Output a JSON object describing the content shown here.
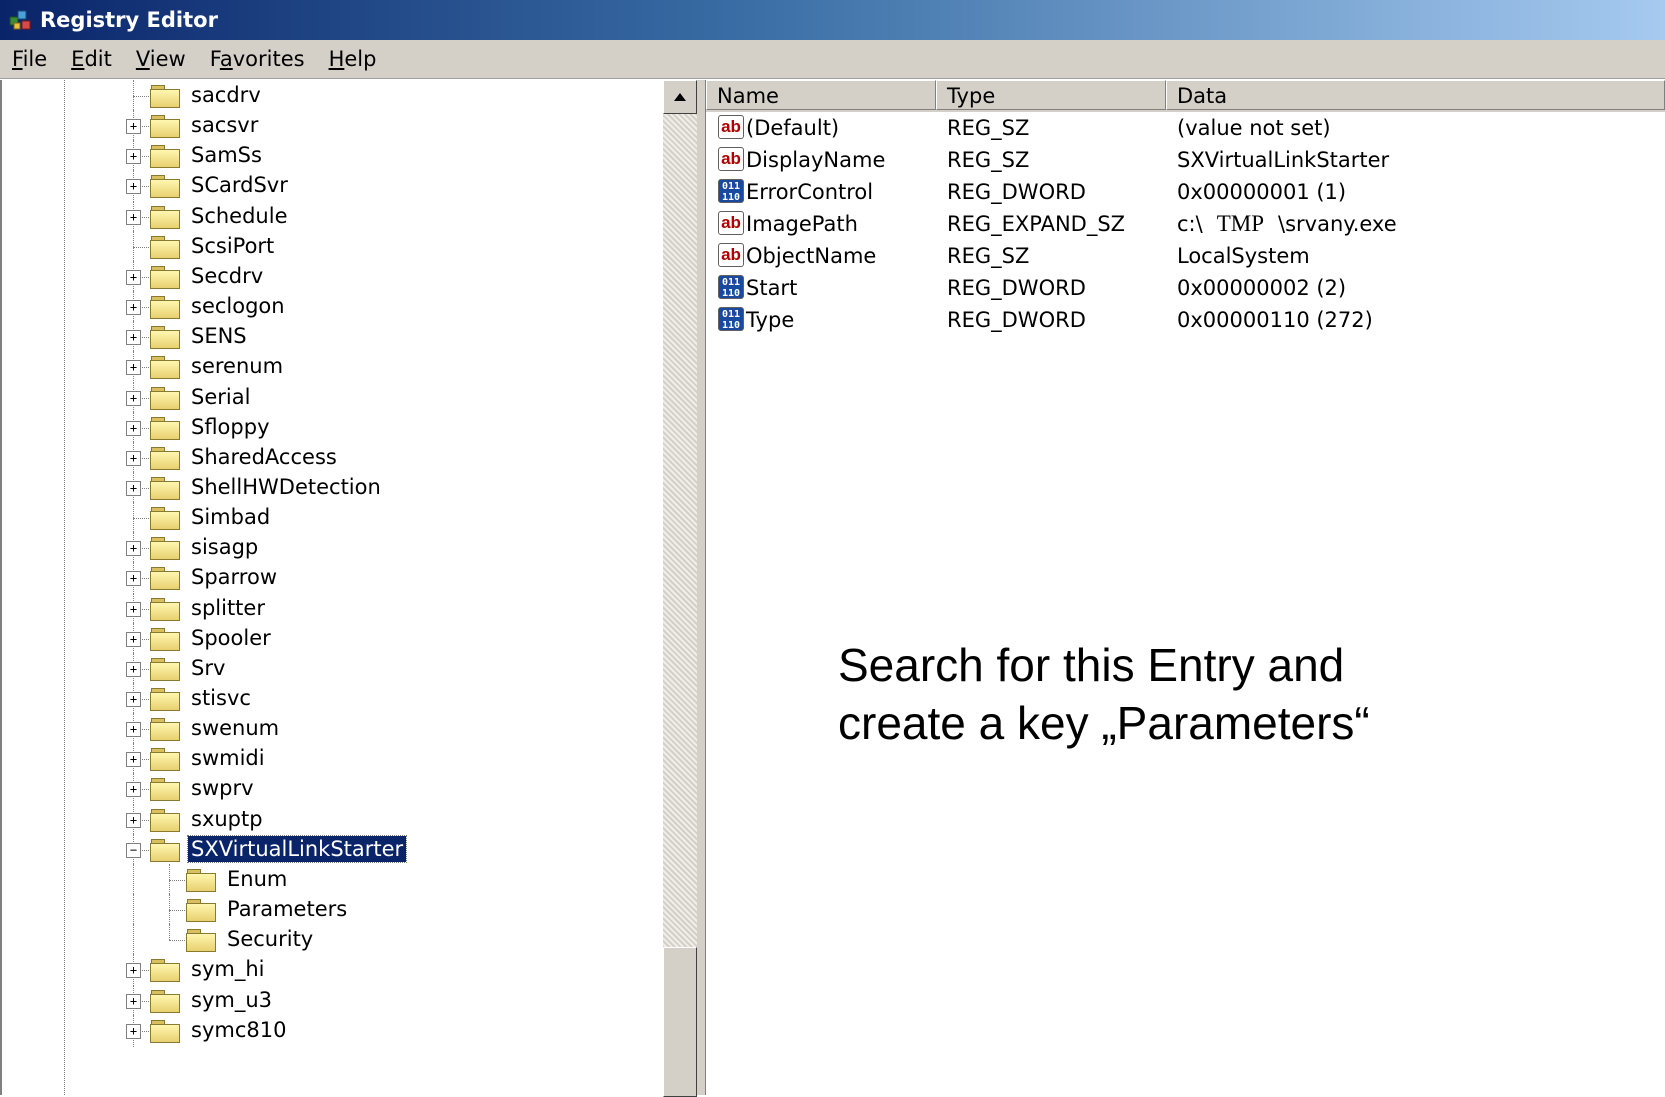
{
  "window": {
    "title": "Registry Editor"
  },
  "menu": [
    {
      "label": "File"
    },
    {
      "label": "Edit"
    },
    {
      "label": "View"
    },
    {
      "label": "Favorites"
    },
    {
      "label": "Help"
    }
  ],
  "tree": [
    {
      "label": "sacdrv",
      "expander": "",
      "level": 1
    },
    {
      "label": "sacsvr",
      "expander": "+",
      "level": 1
    },
    {
      "label": "SamSs",
      "expander": "+",
      "level": 1
    },
    {
      "label": "SCardSvr",
      "expander": "+",
      "level": 1
    },
    {
      "label": "Schedule",
      "expander": "+",
      "level": 1
    },
    {
      "label": "ScsiPort",
      "expander": "",
      "level": 1
    },
    {
      "label": "Secdrv",
      "expander": "+",
      "level": 1
    },
    {
      "label": "seclogon",
      "expander": "+",
      "level": 1
    },
    {
      "label": "SENS",
      "expander": "+",
      "level": 1
    },
    {
      "label": "serenum",
      "expander": "+",
      "level": 1
    },
    {
      "label": "Serial",
      "expander": "+",
      "level": 1
    },
    {
      "label": "Sfloppy",
      "expander": "+",
      "level": 1
    },
    {
      "label": "SharedAccess",
      "expander": "+",
      "level": 1
    },
    {
      "label": "ShellHWDetection",
      "expander": "+",
      "level": 1
    },
    {
      "label": "Simbad",
      "expander": "",
      "level": 1
    },
    {
      "label": "sisagp",
      "expander": "+",
      "level": 1
    },
    {
      "label": "Sparrow",
      "expander": "+",
      "level": 1
    },
    {
      "label": "splitter",
      "expander": "+",
      "level": 1
    },
    {
      "label": "Spooler",
      "expander": "+",
      "level": 1
    },
    {
      "label": "Srv",
      "expander": "+",
      "level": 1
    },
    {
      "label": "stisvc",
      "expander": "+",
      "level": 1
    },
    {
      "label": "swenum",
      "expander": "+",
      "level": 1
    },
    {
      "label": "swmidi",
      "expander": "+",
      "level": 1
    },
    {
      "label": "swprv",
      "expander": "+",
      "level": 1
    },
    {
      "label": "sxuptp",
      "expander": "+",
      "level": 1
    },
    {
      "label": "SXVirtualLinkStarter",
      "expander": "-",
      "level": 1,
      "selected": true,
      "open": true
    },
    {
      "label": "Enum",
      "expander": "",
      "level": 2
    },
    {
      "label": "Parameters",
      "expander": "",
      "level": 2
    },
    {
      "label": "Security",
      "expander": "",
      "level": 2
    },
    {
      "label": "sym_hi",
      "expander": "+",
      "level": 1
    },
    {
      "label": "sym_u3",
      "expander": "+",
      "level": 1
    },
    {
      "label": "symc810",
      "expander": "+",
      "level": 1
    }
  ],
  "list": {
    "headers": {
      "name": "Name",
      "type": "Type",
      "data": "Data"
    },
    "rows": [
      {
        "icon": "string-value-icon",
        "name": "(Default)",
        "type": "REG_SZ",
        "data": "(value not set)"
      },
      {
        "icon": "string-value-icon",
        "name": "DisplayName",
        "type": "REG_SZ",
        "data": "SXVirtualLinkStarter"
      },
      {
        "icon": "dword-value-icon",
        "name": "ErrorControl",
        "type": "REG_DWORD",
        "data": "0x00000001 (1)"
      },
      {
        "icon": "string-value-icon",
        "name": "ImagePath",
        "type": "REG_EXPAND_SZ",
        "data_parts": [
          "c:\\",
          "TMP",
          "\\srvany.exe"
        ]
      },
      {
        "icon": "string-value-icon",
        "name": "ObjectName",
        "type": "REG_SZ",
        "data": "LocalSystem"
      },
      {
        "icon": "dword-value-icon",
        "name": "Start",
        "type": "REG_DWORD",
        "data": "0x00000002 (2)"
      },
      {
        "icon": "dword-value-icon",
        "name": "Type",
        "type": "REG_DWORD",
        "data": "0x00000110 (272)"
      }
    ]
  },
  "icons": {
    "string": "ab",
    "dword": "011 110"
  },
  "annotation": {
    "line1": "Search for this Entry and",
    "line2": "create a key „Parameters“"
  }
}
